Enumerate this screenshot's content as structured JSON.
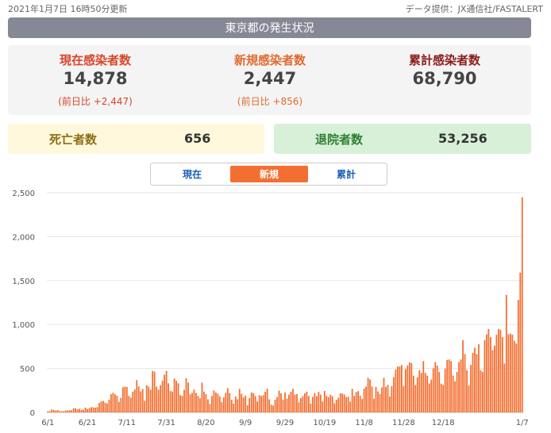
{
  "header": {
    "updated": "2021年1月7日 16時50分更新",
    "source": "データ提供：JX通信社/FASTALERT",
    "title": "東京都の発生状況"
  },
  "stats": {
    "current": {
      "label": "現在感染者数",
      "value": "14,878",
      "diff": "(前日比 +2,447)"
    },
    "new": {
      "label": "新規感染者数",
      "value": "2,447",
      "diff": "(前日比 +856)"
    },
    "total": {
      "label": "累計感染者数",
      "value": "68,790"
    },
    "deaths": {
      "label": "死亡者数",
      "value": "656"
    },
    "recovered": {
      "label": "退院者数",
      "value": "53,256"
    }
  },
  "tabs": [
    "現在",
    "新規",
    "累計"
  ],
  "active_tab": "新規",
  "colors": {
    "current": "#d9452b",
    "new": "#e06a2d",
    "total": "#8b1a1a",
    "deaths": "#8c6d12",
    "recovered": "#2e7d32",
    "bar": "#f36f31",
    "title_bar": "#878895"
  },
  "chart_data": {
    "type": "bar",
    "title": "",
    "xlabel": "",
    "ylabel": "",
    "ylim": [
      0,
      2500
    ],
    "yticks": [
      0,
      500,
      1000,
      1500,
      2000,
      2500
    ],
    "ytick_labels": [
      "0",
      "500",
      "1,000",
      "1,500",
      "2,000",
      "2,500"
    ],
    "xtick_labels": [
      "6/1",
      "6/21",
      "7/11",
      "7/31",
      "8/20",
      "9/9",
      "9/29",
      "10/19",
      "11/8",
      "11/28",
      "12/18",
      "1/7"
    ],
    "grid": true,
    "series": [
      {
        "values": [
          13,
          12,
          34,
          28,
          20,
          26,
          14,
          13,
          12,
          22,
          22,
          25,
          24,
          47,
          48,
          35,
          41,
          29,
          31,
          55,
          39,
          48,
          60,
          57,
          54,
          60,
          107,
          124,
          131,
          111,
          102,
          143,
          206,
          224,
          206,
          188,
          119,
          165,
          286,
          293,
          290,
          188,
          168,
          237,
          260,
          367,
          295,
          239,
          266,
          131,
          309,
          292,
          258,
          472,
          463,
          292,
          258,
          309,
          360,
          429,
          472,
          331,
          243,
          236,
          385,
          360,
          331,
          197,
          188,
          258,
          389,
          339,
          206,
          222,
          258,
          222,
          187,
          161,
          339,
          236,
          207,
          148,
          95,
          186,
          250,
          226,
          212,
          182,
          116,
          170,
          223,
          276,
          221,
          143,
          100,
          182,
          150,
          267,
          211,
          170,
          191,
          80,
          163,
          226,
          220,
          187,
          125,
          195,
          187,
          195,
          235,
          270,
          148,
          88,
          78,
          144,
          174,
          248,
          216,
          144,
          226,
          157,
          202,
          235,
          269,
          203,
          209,
          115,
          162,
          186,
          217,
          235,
          186,
          100,
          177,
          218,
          185,
          233,
          203,
          124,
          244,
          188,
          173,
          202,
          184,
          105,
          142,
          166,
          218,
          215,
          203,
          174,
          178,
          122,
          269,
          188,
          231,
          242,
          189,
          152,
          270,
          294,
          393,
          374,
          294,
          157,
          290,
          239,
          209,
          285,
          393,
          291,
          313,
          182,
          298,
          401,
          487,
          522,
          522,
          539,
          298,
          493,
          534,
          570,
          561,
          418,
          311,
          401,
          481,
          449,
          584,
          449,
          418,
          330,
          372,
          502,
          572,
          533,
          459,
          327,
          310,
          499,
          595,
          602,
          584,
          418,
          352,
          460,
          572,
          602,
          822,
          664,
          480,
          305,
          540,
          678,
          736,
          664,
          776,
          481,
          460,
          822,
          888,
          949,
          856,
          708,
          760,
          884,
          949,
          940,
          856,
          556,
          1337,
          888,
          897,
          884,
          816,
          783,
          1278,
          1591,
          2447
        ]
      }
    ]
  }
}
